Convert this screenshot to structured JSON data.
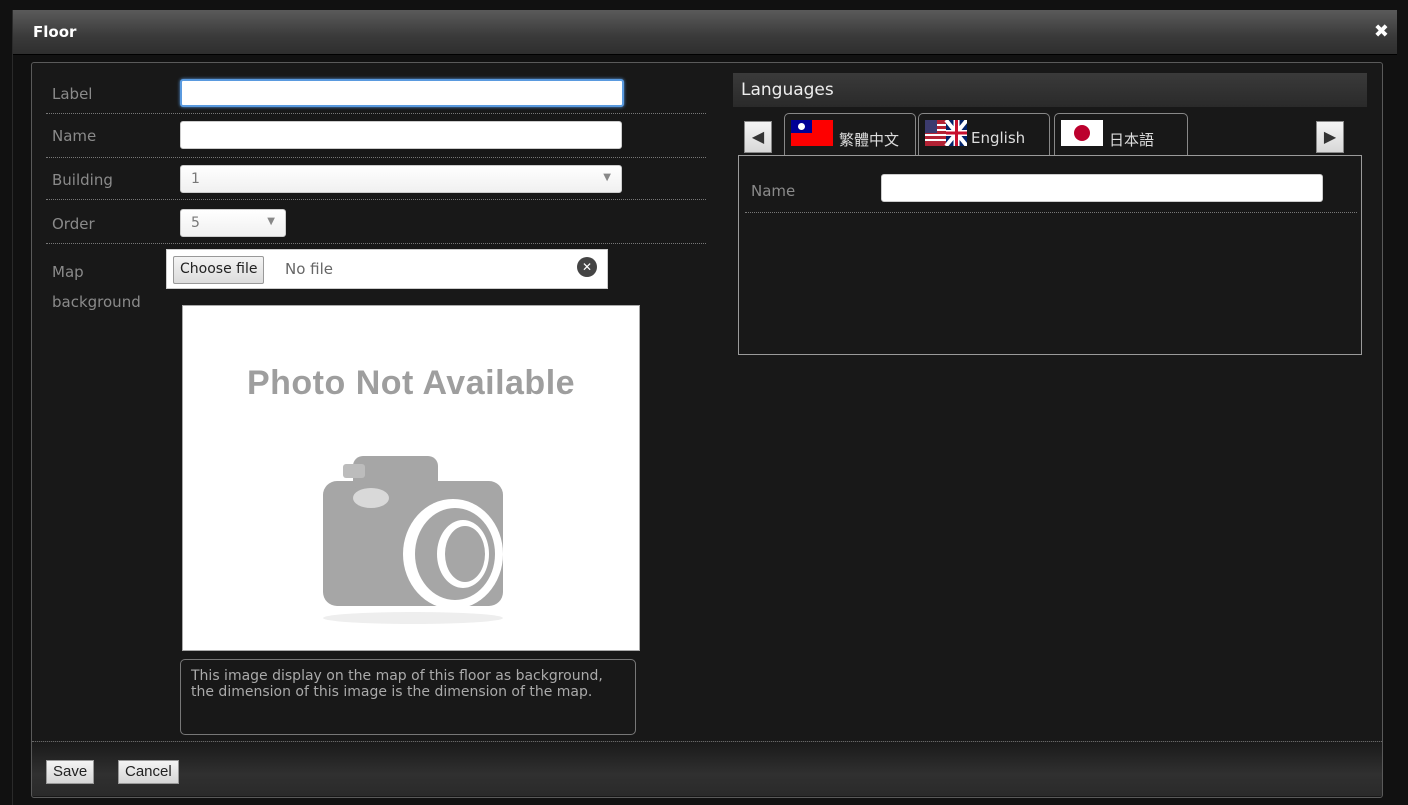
{
  "dialog": {
    "title": "Floor",
    "close_icon": "close-icon",
    "colors": {
      "titlebar": "#4a4a4a",
      "background": "#111111",
      "focus": "#5a9adf"
    }
  },
  "form": {
    "label": {
      "label": "Label",
      "value": ""
    },
    "name": {
      "label": "Name",
      "value": ""
    },
    "building": {
      "label": "Building",
      "selected": "1"
    },
    "order": {
      "label": "Order",
      "selected": "5"
    },
    "map_background": {
      "label_line1": "Map",
      "label_line2": "background",
      "choose_label": "Choose file",
      "file_status": "No file",
      "placeholder_text": "Photo Not Available",
      "help": "This image display on the map of this floor as background, the dimension of this image is the dimension of the map."
    }
  },
  "buttons": {
    "save": "Save",
    "cancel": "Cancel"
  },
  "languages": {
    "title": "Languages",
    "prev_icon": "arrow-left-icon",
    "next_icon": "arrow-right-icon",
    "tabs": [
      {
        "label": "繁體中文",
        "flag": "taiwan-flag-icon",
        "active": true
      },
      {
        "label": "English",
        "flag": "uk-us-flag-icon",
        "active": false
      },
      {
        "label": "日本語",
        "flag": "japan-flag-icon",
        "active": false
      }
    ],
    "panel": {
      "name_label": "Name",
      "name_value": ""
    }
  }
}
